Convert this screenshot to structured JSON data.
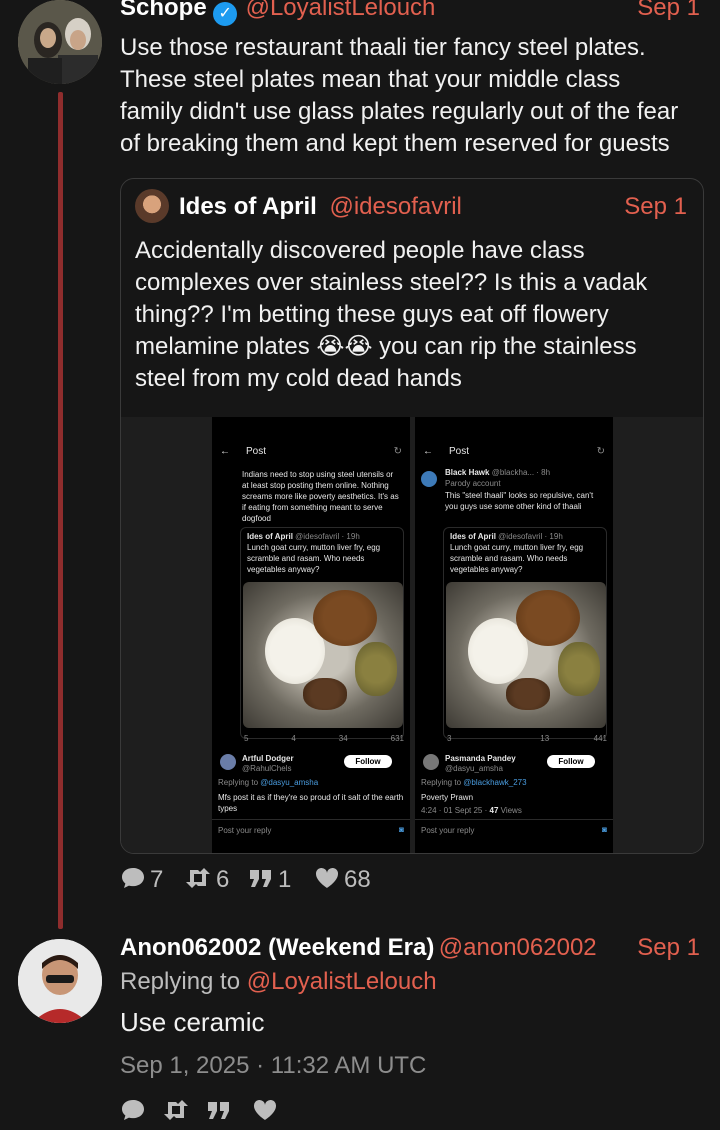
{
  "main_post": {
    "name": "Schope",
    "handle": "@LoyalistLelouch",
    "date": "Sep 1",
    "text_lines": [
      "Use those restaurant thaali tier fancy steel plates.",
      "These steel plates mean that your middle class",
      "family didn't use glass plates regularly out of the fear",
      "of breaking them and kept them reserved for guests"
    ],
    "verified_icon": "verified-check-icon"
  },
  "quoted": {
    "name": "Ides of April",
    "handle": "@idesofavril",
    "date": "Sep 1",
    "text_lines": [
      "Accidentally discovered people have class",
      "complexes over stainless steel?? Is this a vadak",
      "thing?? I'm betting these guys eat off flowery",
      "melamine plates 😭😭 you can rip the stainless",
      "steel from my cold dead hands"
    ]
  },
  "shot_left": {
    "header": "Post",
    "top_text": "Indians need to stop using steel utensils or at least stop posting them online. Nothing screams more like poverty aesthetics. It's as if eating from something meant to serve dogfood",
    "quote_author": "Ides of April",
    "quote_handle": "@idesofavril · 19h",
    "quote_text": "Lunch goat curry, mutton liver fry, egg scramble and rasam. Who needs vegetables anyway?",
    "stats": [
      "5",
      "4",
      "34",
      "631"
    ],
    "reply_name": "Artful Dodger",
    "reply_handle": "@RahulChels",
    "follow": "Follow",
    "replying_to_label": "Replying to",
    "replying_to": "@dasyu_amsha",
    "reply_text": "Mfs post it as if they're so proud of it salt of the earth types",
    "post_reply": "Post your reply"
  },
  "shot_right": {
    "header": "Post",
    "author": "Black Hawk",
    "author_meta": "@blackha... · 8h",
    "parody": "Parody account",
    "top_text": "This \"steel thaali\" looks so repulsive, can't you guys use some other kind of thaali",
    "quote_author": "Ides of April",
    "quote_handle": "@idesofavril · 19h",
    "quote_text": "Lunch goat curry, mutton liver fry, egg scramble and rasam. Who needs vegetables anyway?",
    "stats": [
      "3",
      "",
      "13",
      "441"
    ],
    "reply_name": "Pasmanda Pandey",
    "reply_handle": "@dasyu_amsha",
    "follow": "Follow",
    "replying_to_label": "Replying to",
    "replying_to": "@blackhawk_273",
    "reply_text": "Poverty Prawn",
    "timestamp": "4:24 · 01 Sept 25 ·",
    "views_count": "47",
    "views_label": "Views",
    "post_reply": "Post your reply"
  },
  "main_stats": {
    "replies": "7",
    "reposts": "6",
    "quotes": "1",
    "likes": "68"
  },
  "reply_post": {
    "name": "Anon062002 (Weekend Era)",
    "handle": "@anon062002",
    "date": "Sep 1",
    "replying_label": "Replying to",
    "replying_to": "@LoyalistLelouch",
    "text": "Use ceramic",
    "timestamp": "Sep 1, 2025 · 11:32 AM UTC"
  },
  "colors": {
    "background": "#161616",
    "accent": "#e2604f",
    "thread_line": "#8f2d2d",
    "verified": "#1d9bf0"
  }
}
